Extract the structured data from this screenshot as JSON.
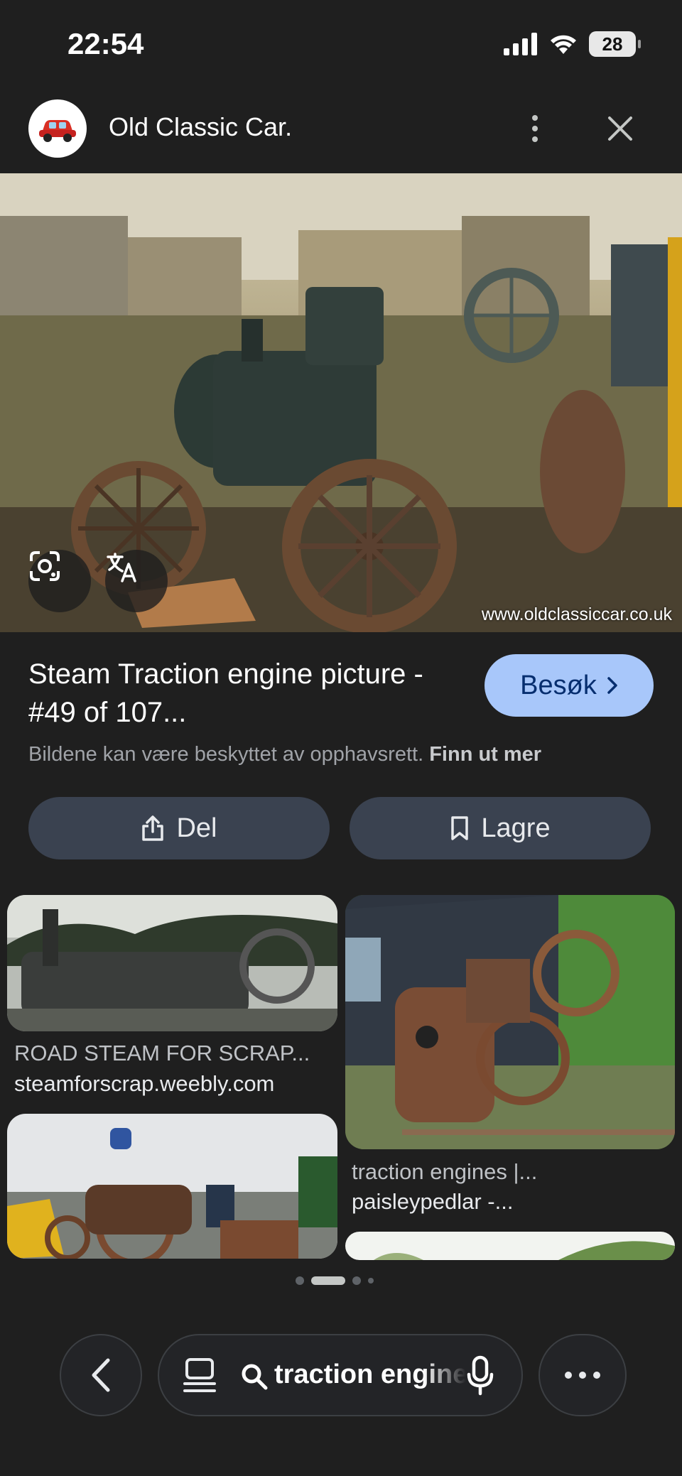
{
  "status_bar": {
    "time": "22:54",
    "battery": "28"
  },
  "header": {
    "site_name": "Old Classic Car."
  },
  "hero": {
    "watermark": "www.oldclassiccar.co.uk"
  },
  "result": {
    "title": "Steam Traction engine picture - #49 of 107...",
    "visit_label": "Besøk",
    "copyright_text": "Bildene kan være beskyttet av opphavsrett.",
    "learn_more": "Finn ut mer"
  },
  "actions": {
    "share_label": "Del",
    "save_label": "Lagre"
  },
  "related": [
    {
      "title": "ROAD STEAM FOR SCRAP...",
      "domain": "steamforscrap.weebly.com"
    },
    {
      "title": "traction engines |...",
      "domain": "paisleypedlar -..."
    }
  ],
  "pagination": {
    "active_index": 1,
    "count": 4
  },
  "bottom_bar": {
    "search_query": "traction engines"
  },
  "colors": {
    "background": "#1f1f1f",
    "accent": "#a8c7fa",
    "button": "#3a4250"
  }
}
